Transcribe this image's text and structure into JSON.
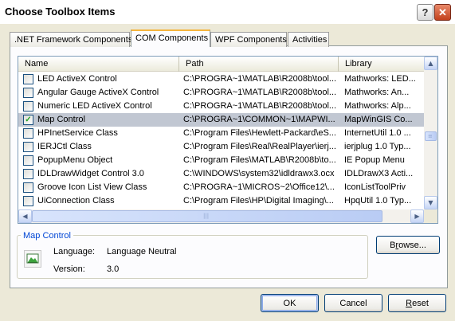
{
  "window": {
    "title": "Choose Toolbox Items"
  },
  "tabs": [
    {
      "label": ".NET Framework Components",
      "active": false
    },
    {
      "label": "COM Components",
      "active": true
    },
    {
      "label": "WPF Components",
      "active": false
    },
    {
      "label": "Activities",
      "active": false
    }
  ],
  "list": {
    "columns": [
      "Name",
      "Path",
      "Library"
    ],
    "rows": [
      {
        "checked": false,
        "name": "LED ActiveX Control",
        "path": "C:\\PROGRA~1\\MATLAB\\R2008b\\tool...",
        "library": "Mathworks: LED...",
        "selected": false
      },
      {
        "checked": false,
        "name": "Angular Gauge ActiveX Control",
        "path": "C:\\PROGRA~1\\MATLAB\\R2008b\\tool...",
        "library": "Mathworks: An...",
        "selected": false
      },
      {
        "checked": false,
        "name": "Numeric LED ActiveX Control",
        "path": "C:\\PROGRA~1\\MATLAB\\R2008b\\tool...",
        "library": "Mathworks: Alp...",
        "selected": false
      },
      {
        "checked": true,
        "name": "Map Control",
        "path": "C:\\PROGRA~1\\COMMON~1\\MAPWI...",
        "library": "MapWinGIS Co...",
        "selected": true
      },
      {
        "checked": false,
        "name": "HPInetService Class",
        "path": "C:\\Program Files\\Hewlett-Packard\\eS...",
        "library": "InternetUtil 1.0 ...",
        "selected": false
      },
      {
        "checked": false,
        "name": "IERJCtl Class",
        "path": "C:\\Program Files\\Real\\RealPlayer\\ierj...",
        "library": "ierjplug 1.0 Typ...",
        "selected": false
      },
      {
        "checked": false,
        "name": "PopupMenu Object",
        "path": "C:\\Program Files\\MATLAB\\R2008b\\to...",
        "library": "IE Popup Menu",
        "selected": false
      },
      {
        "checked": false,
        "name": "IDLDrawWidget Control 3.0",
        "path": "C:\\WINDOWS\\system32\\idldrawx3.ocx",
        "library": "IDLDrawX3 Acti...",
        "selected": false
      },
      {
        "checked": false,
        "name": "Groove Icon List View Class",
        "path": "C:\\PROGRA~1\\MICROS~2\\Office12\\...",
        "library": "IconListToolPriv",
        "selected": false
      },
      {
        "checked": false,
        "name": "UiConnection Class",
        "path": "C:\\Program Files\\HP\\Digital Imaging\\...",
        "library": "HpqUtil 1.0 Typ...",
        "selected": false
      }
    ]
  },
  "details": {
    "group_title": "Map Control",
    "language_label": "Language:",
    "language_value": "Language Neutral",
    "version_label": "Version:",
    "version_value": "3.0"
  },
  "buttons": {
    "browse_pre": "B",
    "browse_u": "r",
    "browse_post": "owse...",
    "ok": "OK",
    "cancel": "Cancel",
    "reset_u": "R",
    "reset_post": "eset"
  },
  "icons": {
    "help": "question-mark",
    "close": "x-mark",
    "check": "checkmark",
    "control": "map-control-icon"
  }
}
